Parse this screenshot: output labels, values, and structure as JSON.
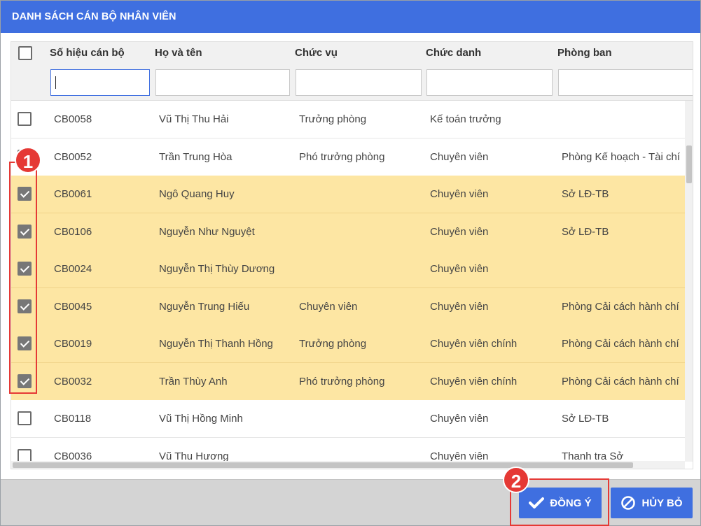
{
  "dialog": {
    "title": "DANH SÁCH CÁN BỘ NHÂN VIÊN"
  },
  "columns": [
    {
      "key": "code",
      "label": "Số hiệu cán bộ"
    },
    {
      "key": "name",
      "label": "Họ và tên"
    },
    {
      "key": "position",
      "label": "Chức vụ"
    },
    {
      "key": "title",
      "label": "Chức danh"
    },
    {
      "key": "department",
      "label": "Phòng ban"
    }
  ],
  "filters": [
    "",
    "",
    "",
    "",
    ""
  ],
  "rows": [
    {
      "selected": false,
      "code": "CB0058",
      "name": "Vũ Thị Thu Hải",
      "position": "Trưởng phòng",
      "title": "Kế toán trưởng",
      "department": ""
    },
    {
      "selected": false,
      "code": "CB0052",
      "name": "Trần Trung Hòa",
      "position": "Phó trưởng phòng",
      "title": "Chuyên viên",
      "department": "Phòng Kế hoạch - Tài chí"
    },
    {
      "selected": true,
      "code": "CB0061",
      "name": "Ngô Quang Huy",
      "position": "",
      "title": "Chuyên viên",
      "department": "Sở LĐ-TB"
    },
    {
      "selected": true,
      "code": "CB0106",
      "name": "Nguyễn Như Nguyệt",
      "position": "",
      "title": "Chuyên viên",
      "department": "Sở LĐ-TB"
    },
    {
      "selected": true,
      "code": "CB0024",
      "name": "Nguyễn Thị Thùy Dương",
      "position": "",
      "title": "Chuyên viên",
      "department": ""
    },
    {
      "selected": true,
      "code": "CB0045",
      "name": "Nguyễn Trung Hiếu",
      "position": "Chuyên viên",
      "title": "Chuyên viên",
      "department": "Phòng Cải cách hành chí"
    },
    {
      "selected": true,
      "code": "CB0019",
      "name": "Nguyễn Thị Thanh Hồng",
      "position": "Trưởng phòng",
      "title": "Chuyên viên chính",
      "department": "Phòng Cải cách hành chí"
    },
    {
      "selected": true,
      "code": "CB0032",
      "name": "Trần Thùy Anh",
      "position": "Phó trưởng phòng",
      "title": "Chuyên viên chính",
      "department": "Phòng Cải cách hành chí"
    },
    {
      "selected": false,
      "code": "CB0118",
      "name": "Vũ Thị Hồng Minh",
      "position": "",
      "title": "Chuyên viên",
      "department": "Sở LĐ-TB"
    },
    {
      "selected": false,
      "code": "CB0036",
      "name": "Vũ Thu Hương",
      "position": "",
      "title": "Chuyên viên",
      "department": "Thanh tra Sở"
    }
  ],
  "footer": {
    "ok_label": "ĐỒNG Ý",
    "cancel_label": "HỦY BỎ"
  },
  "annotations": {
    "step1": "1",
    "step2": "2"
  },
  "colors": {
    "primary": "#3f6fe0",
    "selected_row": "#fde6a3",
    "annotation": "#e53935"
  },
  "icons": {
    "ok": "check-icon",
    "cancel": "ban-icon"
  }
}
